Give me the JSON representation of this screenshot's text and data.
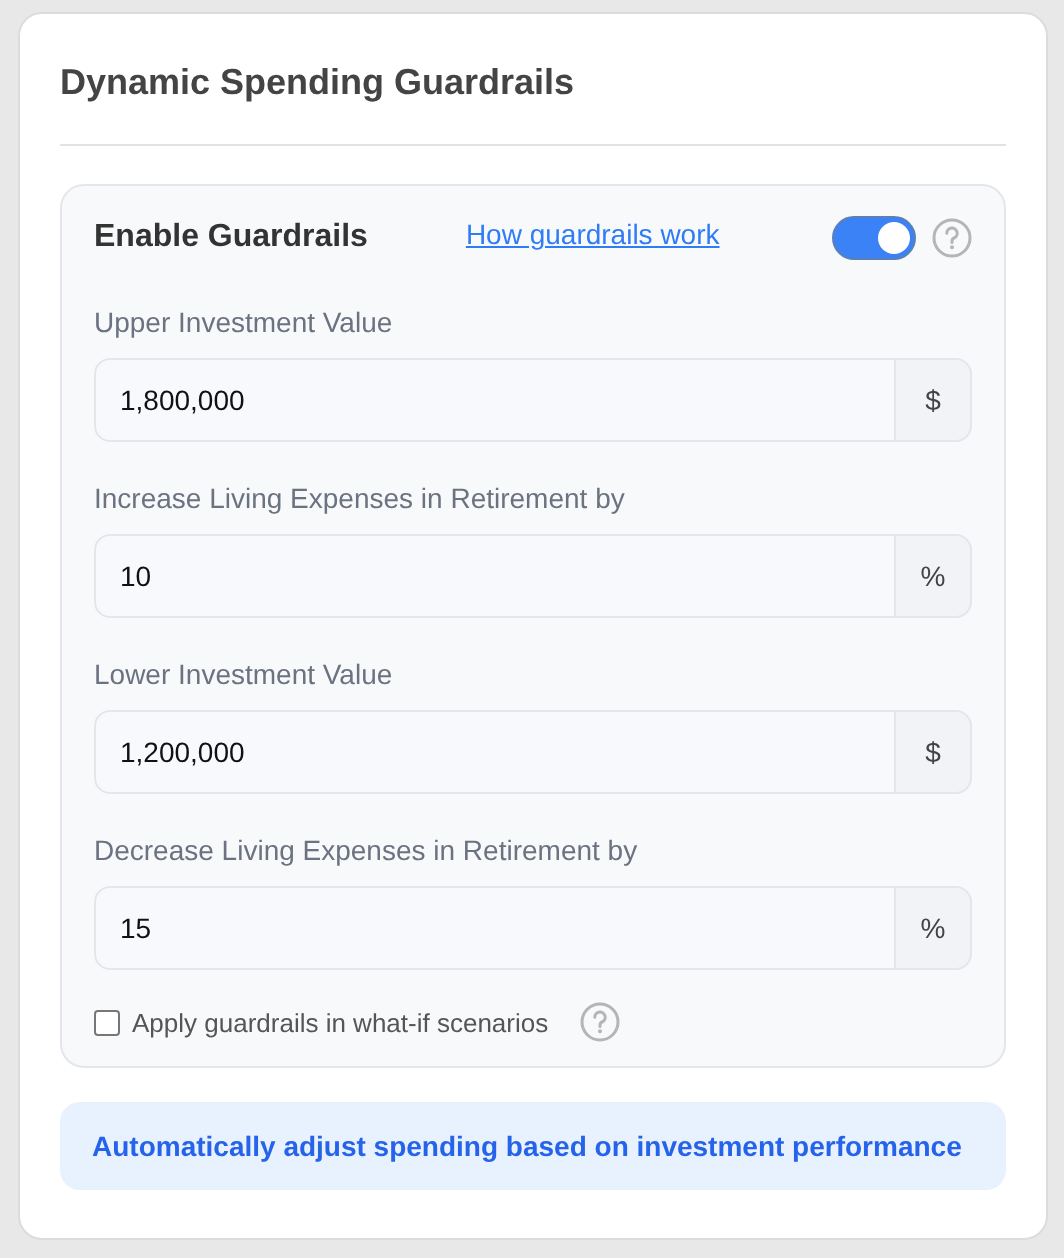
{
  "title": "Dynamic Spending Guardrails",
  "panel": {
    "heading": "Enable Guardrails",
    "link": "How guardrails work",
    "enabled": {
      "on": true
    },
    "fields": [
      {
        "label": "Upper Investment Value",
        "value": "1,800,000",
        "unit": "$"
      },
      {
        "label": "Increase Living Expenses in Retirement by",
        "value": "10",
        "unit": "%"
      },
      {
        "label": "Lower Investment Value",
        "value": "1,200,000",
        "unit": "$"
      },
      {
        "label": "Decrease Living Expenses in Retirement by",
        "value": "15",
        "unit": "%"
      }
    ],
    "option": {
      "label": "Apply guardrails in what-if scenarios",
      "checked": false
    }
  },
  "banner": "Automatically adjust spending based on investment performance"
}
